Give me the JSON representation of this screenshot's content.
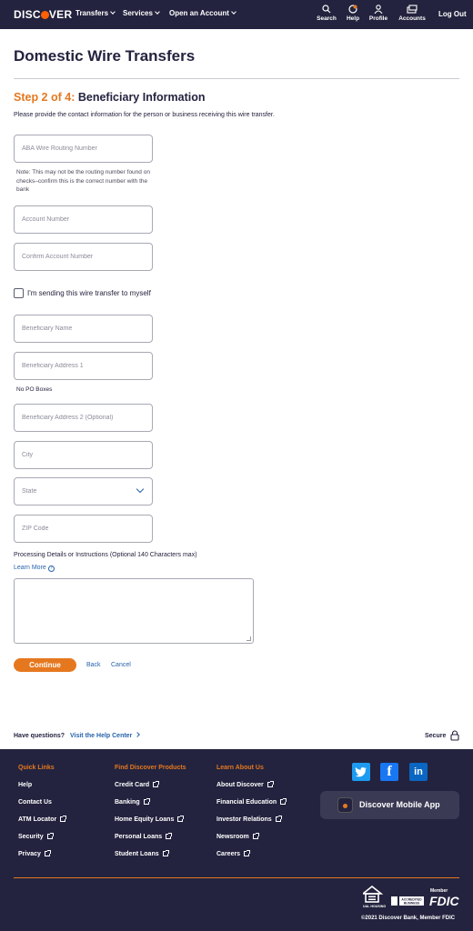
{
  "header": {
    "logo": "DISCOVER",
    "nav": [
      "Transfers",
      "Services",
      "Open an Account"
    ],
    "icons": [
      {
        "label": "Search",
        "icon": "search-icon"
      },
      {
        "label": "Help",
        "icon": "help-icon"
      },
      {
        "label": "Profile",
        "icon": "profile-icon"
      },
      {
        "label": "Accounts",
        "icon": "accounts-icon"
      }
    ],
    "logout": "Log Out"
  },
  "page": {
    "title": "Domestic Wire Transfers",
    "step_prefix": "Step 2 of 4:",
    "step_title": "Beneficiary Information",
    "instructions": "Please provide the contact information for the person or business receiving this wire transfer."
  },
  "form": {
    "routing_placeholder": "ABA Wire Routing Number",
    "routing_note": "Note: This may not be the routing number found on checks–confirm this is the correct number with the bank",
    "account_placeholder": "Account Number",
    "confirm_account_placeholder": "Confirm Account Number",
    "self_checkbox_label": "I'm sending this wire transfer to myself",
    "self_checkbox_checked": false,
    "beneficiary_name_placeholder": "Beneficiary Name",
    "address1_placeholder": "Beneficiary Address 1",
    "address1_note": "No PO Boxes",
    "address2_placeholder": "Beneficiary Address 2 (Optional)",
    "city_placeholder": "City",
    "state_placeholder": "State",
    "zip_placeholder": "ZIP Code",
    "processing_label": "Processing Details or Instructions (Optional 140 Characters max)",
    "learn_more": "Learn More",
    "continue": "Continue",
    "back": "Back",
    "cancel": "Cancel"
  },
  "help_bar": {
    "question": "Have questions?",
    "help_link": "Visit the Help Center",
    "secure": "Secure"
  },
  "footer": {
    "quick_links": {
      "heading": "Quick Links",
      "items": [
        "Help",
        "Contact Us",
        "ATM Locator",
        "Security",
        "Privacy"
      ]
    },
    "products": {
      "heading": "Find Discover Products",
      "items": [
        "Credit Card",
        "Banking",
        "Home Equity Loans",
        "Personal Loans",
        "Student Loans"
      ]
    },
    "learn": {
      "heading": "Learn About Us",
      "items": [
        "About Discover",
        "Financial Education",
        "Investor Relations",
        "Newsroom",
        "Careers"
      ]
    },
    "social": [
      {
        "icon": "twitter-icon",
        "color": "#1d9bf0"
      },
      {
        "icon": "facebook-icon",
        "color": "#1877f2"
      },
      {
        "icon": "linkedin-icon",
        "color": "#0a66c2"
      }
    ],
    "app_button": "Discover Mobile App",
    "badges": [
      "EQUAL HOUSING LENDER",
      "ACCREDITED BUSINESS",
      "Member FDIC"
    ],
    "copyright": "©2021 Discover Bank, Member FDIC"
  },
  "colors": {
    "navy": "#23233f",
    "orange": "#e5781f",
    "link_blue": "#2763ab"
  }
}
